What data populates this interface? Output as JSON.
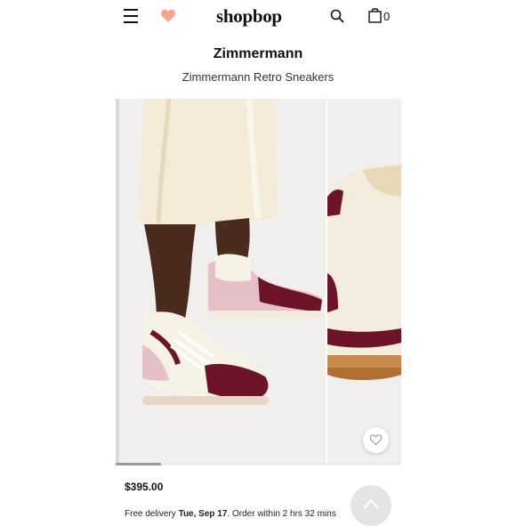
{
  "header": {
    "logo": "shopbop",
    "bag_count": "0",
    "icons": [
      "menu-icon",
      "heart-icon",
      "search-icon",
      "shopping-bag-icon"
    ],
    "heart_color": "#f4a58a"
  },
  "product": {
    "brand": "Zimmermann",
    "name": "Zimmermann Retro Sneakers",
    "price": "$395.00",
    "image_count": 2,
    "current_image_fraction": 0.16
  },
  "delivery": {
    "prefix": "Free delivery ",
    "date": "Tue, Sep 17",
    "suffix": ". Order within 2 hrs 32 mins"
  },
  "colors": {
    "burgundy": "#6e1428",
    "blush": "#e6c0c7",
    "cream": "#f7f2e6"
  }
}
